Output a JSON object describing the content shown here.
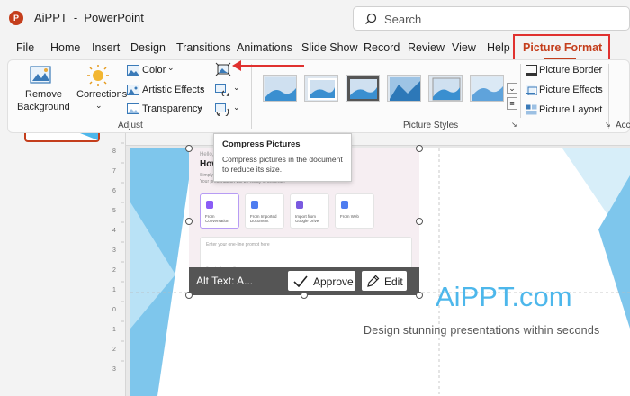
{
  "app": {
    "logo_letter": "P",
    "title": "AiPPT  -  PowerPoint"
  },
  "search": {
    "placeholder": "Search"
  },
  "menu": {
    "tabs": [
      "File",
      "Home",
      "Insert",
      "Design",
      "Transitions",
      "Animations",
      "Slide Show",
      "Record",
      "Review",
      "View",
      "Help"
    ],
    "active_tab": "Picture Format"
  },
  "ribbon": {
    "remove_background": [
      "Remove",
      "Background"
    ],
    "corrections": "Corrections",
    "color": "Color",
    "artistic_effects": "Artistic Effects",
    "transparency": "Transparency",
    "adjust_group": "Adjust",
    "picture_styles_group": "Picture Styles",
    "picture_border": "Picture Border",
    "picture_effects": "Picture Effects",
    "picture_layout": "Picture Layout",
    "accessibility_group_partial": "Acce"
  },
  "tooltip": {
    "title": "Compress Pictures",
    "body": [
      "Compress pictures in the document",
      "to reduce its size."
    ]
  },
  "picture": {
    "small_hello": "Hello,",
    "heading": "How",
    "sub1": "Simply",
    "sub2": "Your presentation will be ready in seconds.",
    "cards": [
      {
        "label": [
          "From",
          "Conversation"
        ],
        "color": "#8a5cf6"
      },
      {
        "label": [
          "From Imported",
          "Document"
        ],
        "color": "#4f7df0"
      },
      {
        "label": [
          "Import from",
          "Google Drive"
        ],
        "color": "#7a5ae0"
      },
      {
        "label": [
          "From Web"
        ],
        "color": "#4f7df0"
      }
    ],
    "prompt_placeholder": "Enter your one-line prompt here",
    "small_note": "Select reference files",
    "small_lang": "English"
  },
  "alt_text": {
    "label": "Alt Text: A...",
    "approve": "Approve",
    "edit": "Edit"
  },
  "slide": {
    "brand": "AiPPT.com",
    "tagline": "Design stunning presentations within seconds"
  },
  "colors": {
    "accent_red": "#e0312f",
    "powerpoint": "#c43e1c",
    "brand_blue": "#4db7eb"
  }
}
